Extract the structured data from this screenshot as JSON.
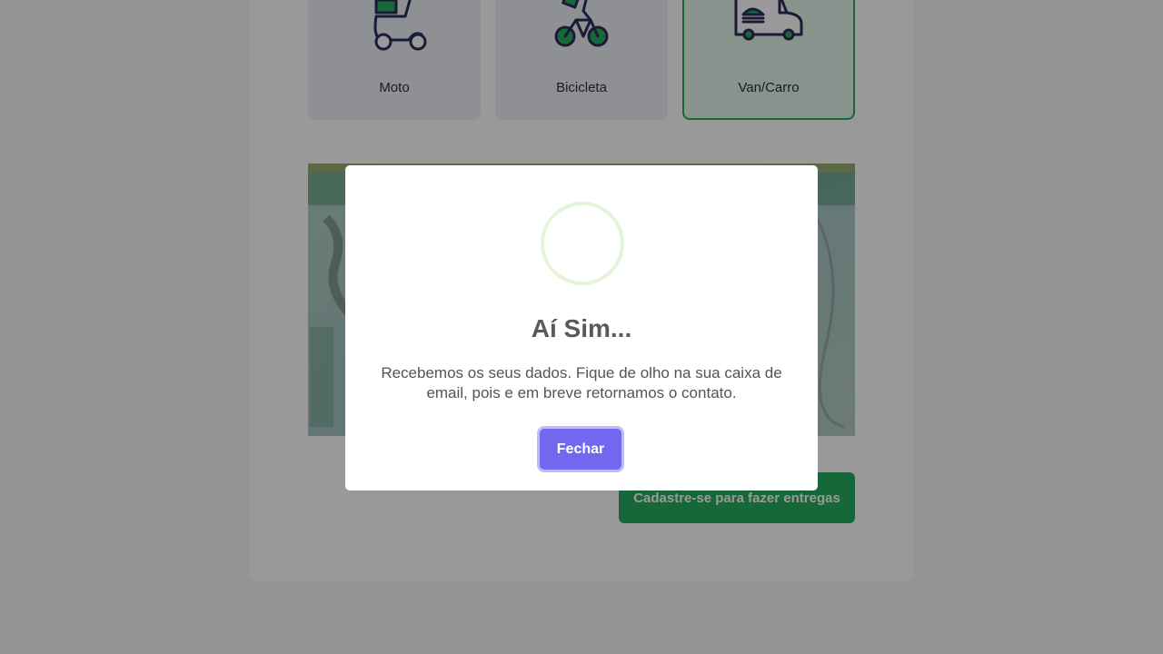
{
  "vehicles": [
    {
      "label": "Moto",
      "icon": "scooter-icon",
      "selected": false
    },
    {
      "label": "Bicicleta",
      "icon": "bicycle-delivery-icon",
      "selected": false
    },
    {
      "label": "Van/Carro",
      "icon": "delivery-van-icon",
      "selected": true
    }
  ],
  "form": {
    "submit_label": "Cadastre-se para fazer entregas"
  },
  "modal": {
    "title": "Aí Sim...",
    "message": "Recebemos os seus dados. Fique de olho na sua caixa de email, pois e em breve retornamos o contato.",
    "close_label": "Fechar",
    "icon": "success-icon"
  },
  "colors": {
    "accent": "#27ae60",
    "icon_stroke": "#2c2f5a",
    "modal_button": "#7367f0",
    "overlay": "rgba(0,0,0,0.4)"
  }
}
